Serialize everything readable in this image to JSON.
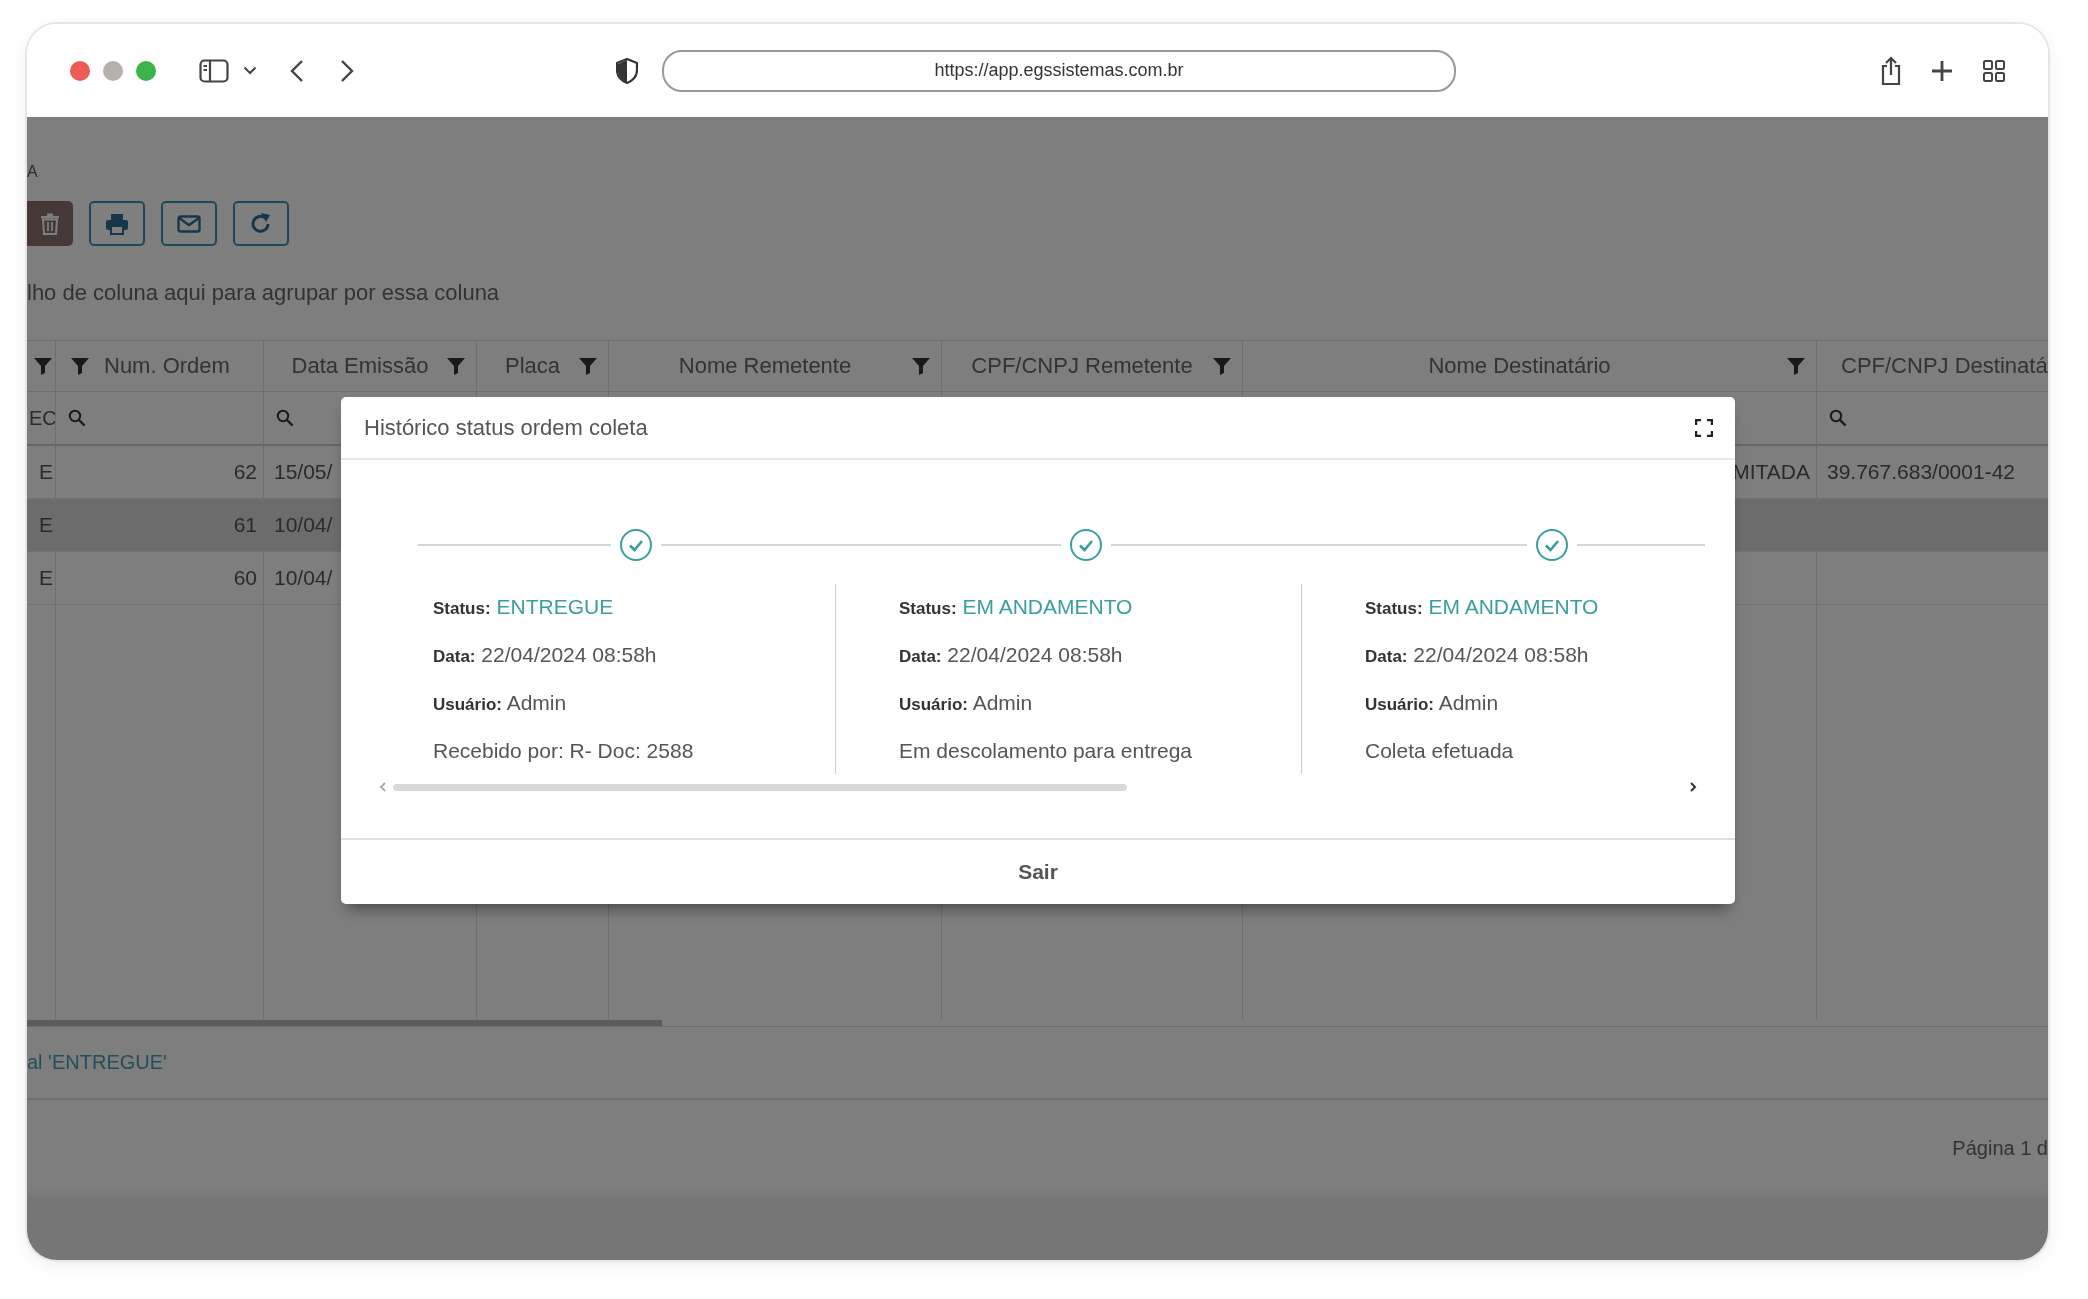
{
  "browser": {
    "url": "https://app.egssistemas.com.br"
  },
  "page": {
    "breadcrumb": "A",
    "toolbar": [
      {
        "kind": "delete"
      },
      {
        "kind": "print"
      },
      {
        "kind": "email"
      },
      {
        "kind": "refresh"
      }
    ],
    "group_hint": "lho de coluna aqui para agrupar por essa coluna"
  },
  "table": {
    "columns": [
      {
        "filter": true,
        "filter_first": false,
        "filter_text": "EC"
      },
      {
        "label": "Num. Ordem",
        "filter": true,
        "filter_first": true,
        "search": true
      },
      {
        "label": "Data Emissão",
        "filter": true,
        "filter_first": false,
        "search": true
      },
      {
        "label": "Placa",
        "filter": true,
        "filter_first": false
      },
      {
        "label": "Nome Remetente",
        "filter": true,
        "filter_first": false
      },
      {
        "label": "CPF/CNPJ Remetente",
        "filter": true,
        "filter_first": false
      },
      {
        "label": "Nome Destinatário",
        "filter": true,
        "filter_first": false
      },
      {
        "label": "CPF/CNPJ Destinatá",
        "filter": false,
        "search": true
      }
    ],
    "rows": [
      {
        "selected": false,
        "cells": [
          "E",
          "62",
          "15/05/",
          null,
          null,
          null,
          "MITADA",
          "39.767.683/0001-42"
        ]
      },
      {
        "selected": true,
        "cells": [
          "E",
          "61",
          "10/04/",
          null,
          null,
          null,
          null,
          null
        ]
      },
      {
        "selected": false,
        "cells": [
          "E",
          "60",
          "10/04/",
          null,
          null,
          null,
          null,
          null
        ]
      }
    ]
  },
  "filter_summary": "al 'ENTREGUE'",
  "pager": "Página 1 d",
  "modal": {
    "title": "Histórico status ordem coleta",
    "steps": [
      {
        "done": true,
        "status_label": "Status:",
        "status": "ENTREGUE",
        "date_label": "Data:",
        "date": "22/04/2024 08:58h",
        "user_label": "Usuário:",
        "user": "Admin",
        "note": "Recebido por: R- Doc: 2588"
      },
      {
        "done": true,
        "status_label": "Status:",
        "status": "EM ANDAMENTO",
        "date_label": "Data:",
        "date": "22/04/2024 08:58h",
        "user_label": "Usuário:",
        "user": "Admin",
        "note": "Em descolamento para entrega"
      },
      {
        "done": true,
        "status_label": "Status:",
        "status": "EM ANDAMENTO",
        "date_label": "Data:",
        "date": "22/04/2024 08:58h",
        "user_label": "Usuário:",
        "user": "Admin",
        "note": "Coleta efetuada"
      }
    ],
    "close_button": "Sair"
  }
}
